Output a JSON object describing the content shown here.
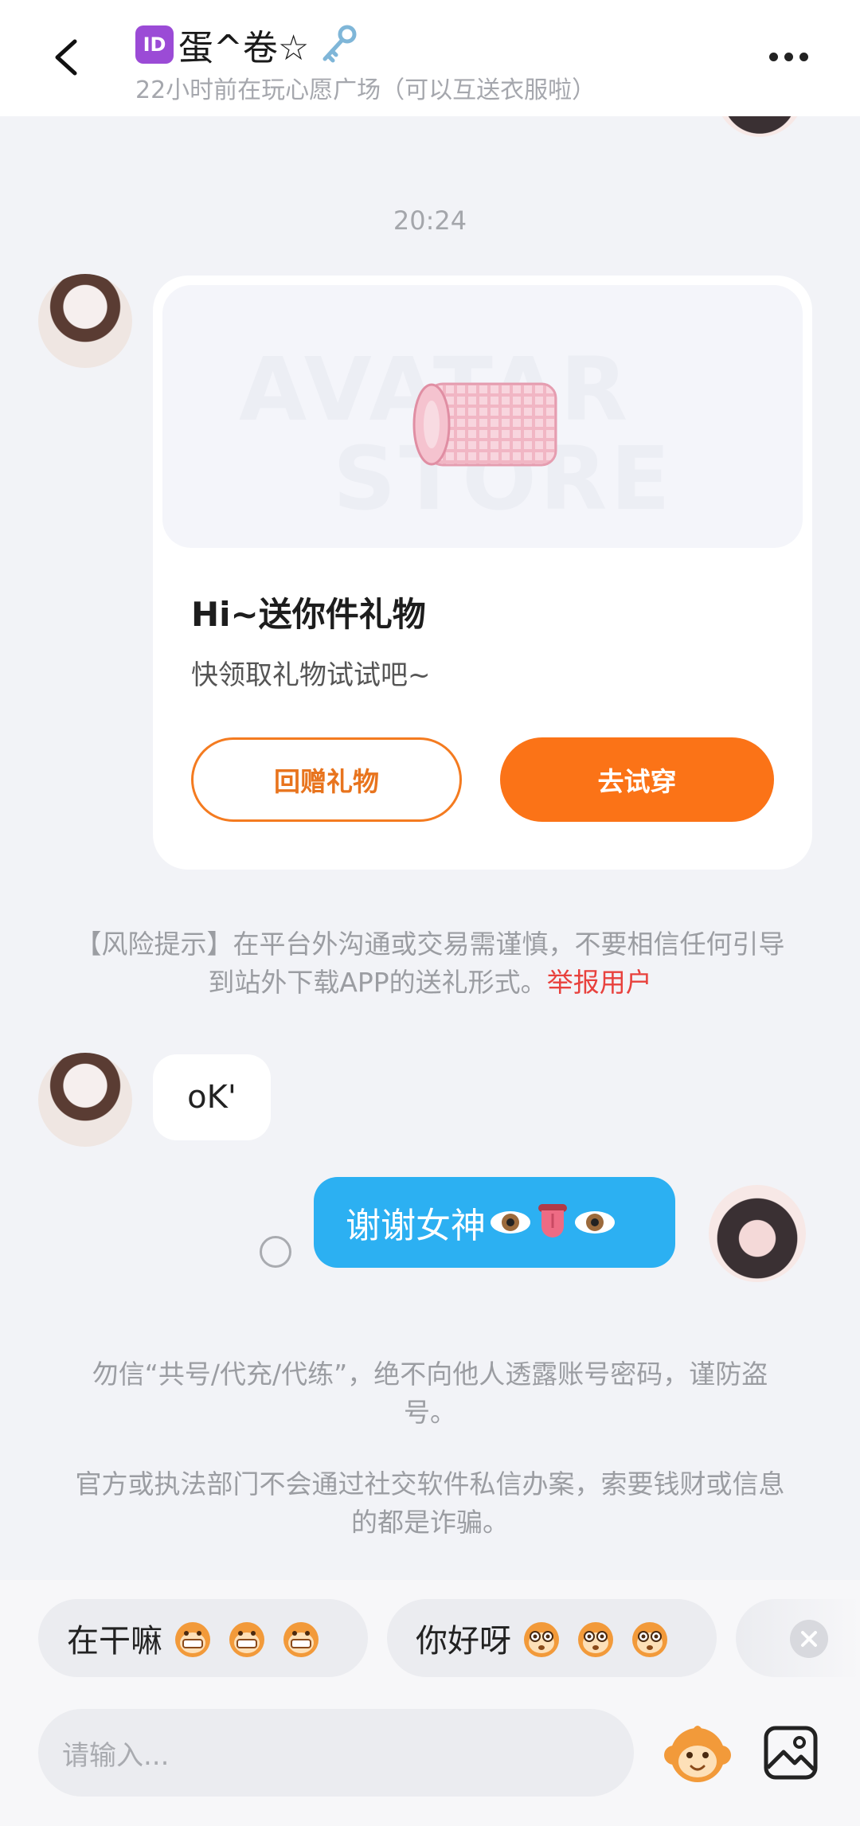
{
  "header": {
    "id_badge": "ID",
    "name": "蛋^卷☆",
    "status": "22小时前在玩心愿广场（可以互送衣服啦）"
  },
  "chat": {
    "timestamp": "20:24",
    "gift_card": {
      "title": "Hi~送你件礼物",
      "subtitle": "快领取礼物试试吧~",
      "watermark_line1": "AVATAR",
      "watermark_line2": "STORE",
      "return_button": "回赠礼物",
      "try_button": "去试穿"
    },
    "risk_notice": {
      "text": "【风险提示】在平台外沟通或交易需谨慎，不要相信任何引导到站外下载APP的送礼形式。",
      "link": "举报用户"
    },
    "messages": [
      {
        "side": "left",
        "text": "oK'"
      },
      {
        "side": "right",
        "text": "谢谢女神"
      }
    ],
    "safety_notices": [
      "勿信“共号/代充/代练”，绝不向他人透露账号密码，谨防盗号。",
      "官方或执法部门不会通过社交软件私信办案，索要钱财或信息的都是诈骗。"
    ]
  },
  "quick_replies": [
    {
      "text": "在干嘛",
      "emoji_icon": "grinning-monkey-icon"
    },
    {
      "text": "你好呀",
      "emoji_icon": "curious-monkey-icon"
    }
  ],
  "composer": {
    "placeholder": "请输入..."
  },
  "colors": {
    "accent_orange": "#fb7317",
    "bubble_blue": "#2cb0f2",
    "report_red": "#e8413d"
  }
}
